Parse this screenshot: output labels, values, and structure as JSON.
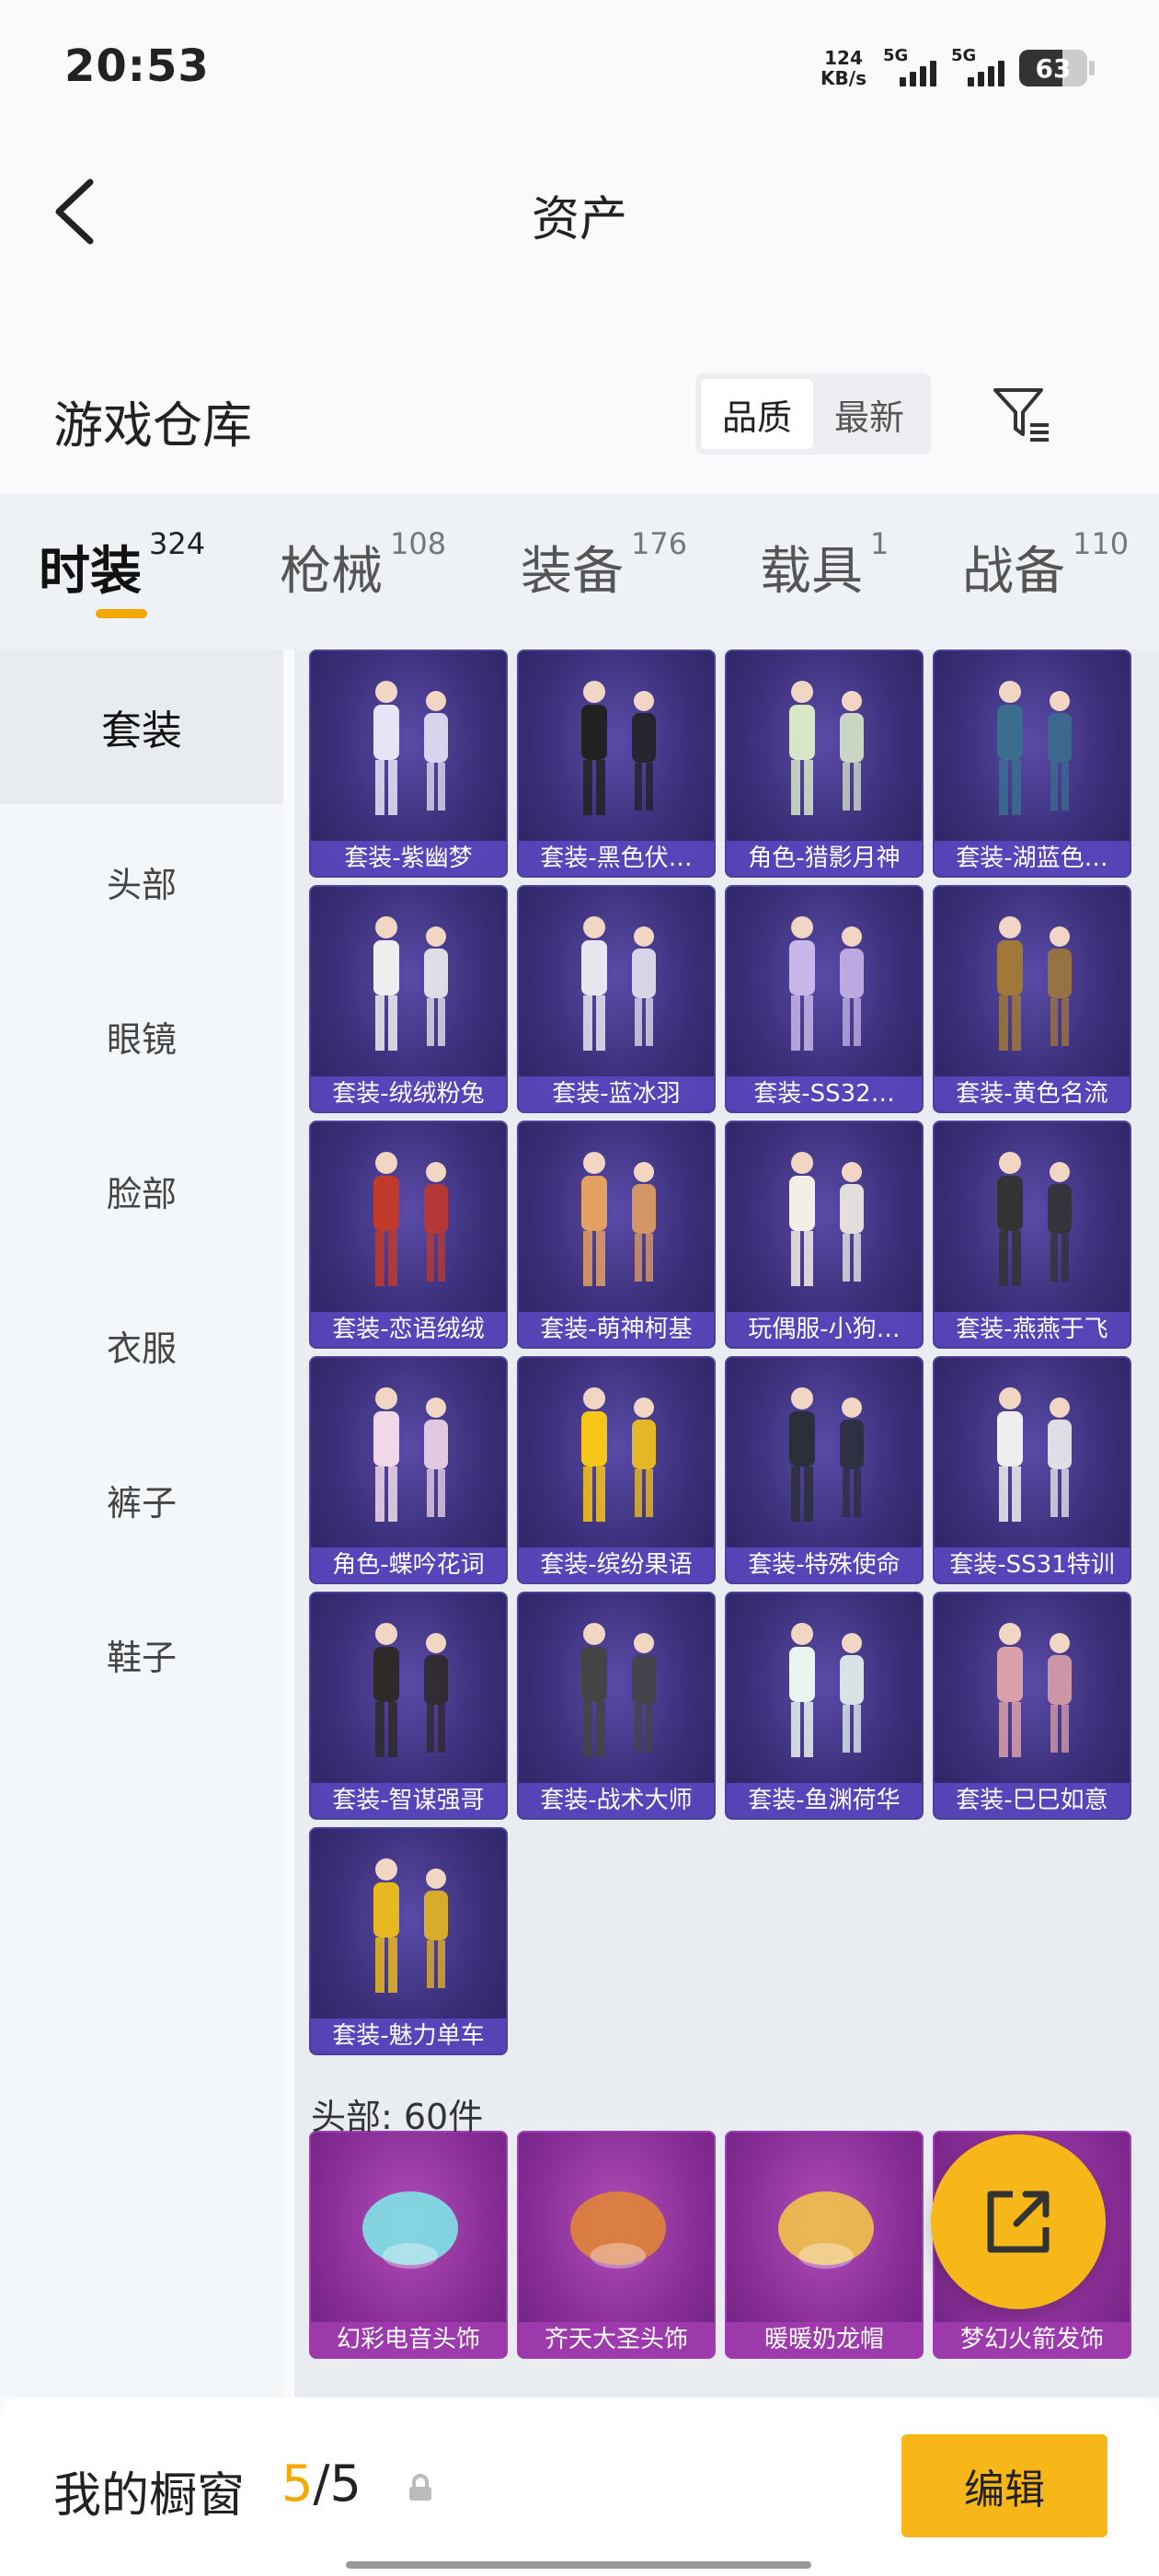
{
  "status": {
    "time": "20:53",
    "netspeed_value": "124",
    "netspeed_unit": "KB/s",
    "sim1": "5G",
    "sim2": "5G",
    "battery": "63",
    "battery_level": 0.63
  },
  "header": {
    "title": "资产"
  },
  "section": {
    "title": "游戏仓库",
    "sort_options": [
      "品质",
      "最新"
    ],
    "active_sort": 0
  },
  "tabs": [
    {
      "label": "时装",
      "count": "324"
    },
    {
      "label": "枪械",
      "count": "108"
    },
    {
      "label": "装备",
      "count": "176"
    },
    {
      "label": "载具",
      "count": "1"
    },
    {
      "label": "战备",
      "count": "110"
    }
  ],
  "active_tab": 0,
  "sidebar": {
    "items": [
      "套装",
      "头部",
      "眼镜",
      "脸部",
      "衣服",
      "裤子",
      "鞋子"
    ],
    "active": 0
  },
  "suits": [
    "套装-紫幽梦",
    "套装-黑色伏…",
    "角色-猎影月神",
    "套装-湖蓝色…",
    "套装-绒绒粉兔",
    "套装-蓝冰羽",
    "套装-SS32…",
    "套装-黄色名流",
    "套装-恋语绒绒",
    "套装-萌神柯基",
    "玩偶服-小狗…",
    "套装-燕燕于飞",
    "角色-蝶吟花词",
    "套装-缤纷果语",
    "套装-特殊使命",
    "套装-SS31特训",
    "套装-智谋强哥",
    "套装-战术大师",
    "套装-鱼渊荷华",
    "套装-巳巳如意",
    "套装-魅力单车"
  ],
  "head_section_label": "头部: 60件",
  "heads": [
    "幻彩电音头饰",
    "齐天大圣头饰",
    "暖暖奶龙帽",
    "梦幻火箭发饰"
  ],
  "bottom": {
    "window_label": "我的橱窗",
    "current": "5",
    "total": "/5",
    "edit_label": "编辑"
  },
  "colors": {
    "accent": "#f7b718",
    "suit_card": "#3a2f78",
    "head_card": "#8b2f98"
  }
}
